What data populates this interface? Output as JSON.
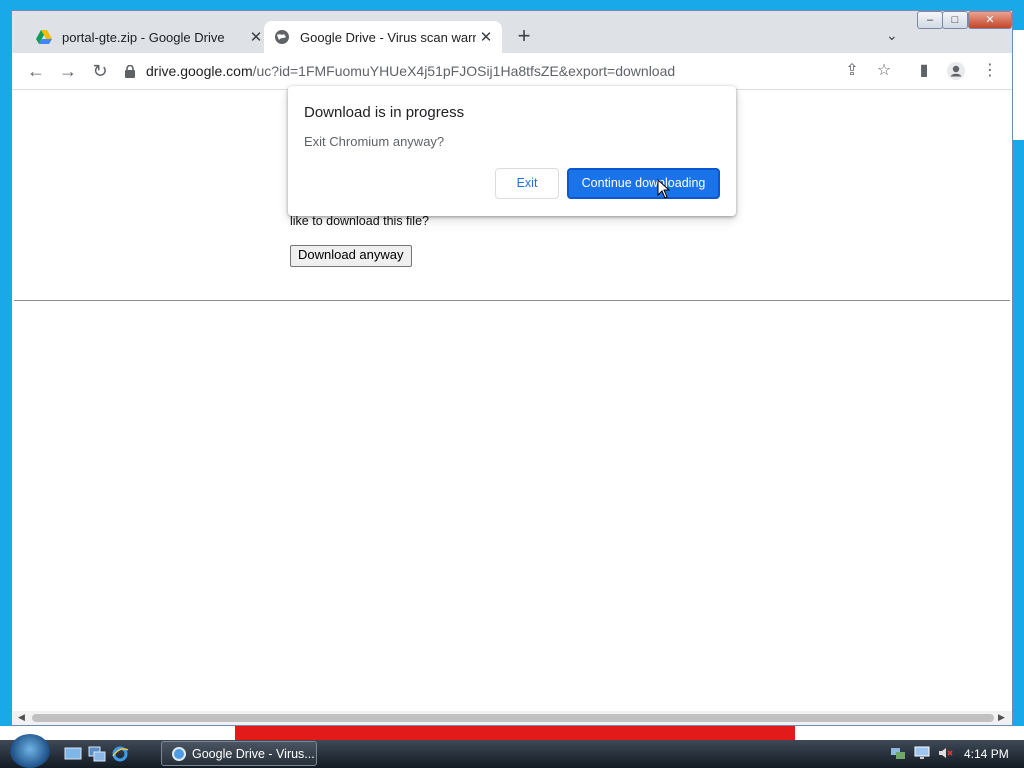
{
  "browser": {
    "tabs": [
      {
        "title": "portal-gte.zip - Google Drive",
        "active": false,
        "favicon": "google-drive-icon"
      },
      {
        "title": "Google Drive - Virus scan warnin",
        "active": true,
        "favicon": "globe-icon"
      }
    ],
    "url_host": "drive.google.com",
    "url_path": "/uc?id=1FMFuomuYHUeX4j51pFJOSij1Ha8tfsZE&export=download"
  },
  "page": {
    "paragraph_tail": "like to download this file?",
    "download_button": "Download anyway"
  },
  "dialog": {
    "title": "Download is in progress",
    "message": "Exit Chromium anyway?",
    "exit_label": "Exit",
    "continue_label": "Continue downloading"
  },
  "taskbar": {
    "task_label": "Google Drive - Virus...",
    "clock": "4:14 PM"
  },
  "colors": {
    "accent": "#1a73e8",
    "desktop": "#19a9e8"
  }
}
